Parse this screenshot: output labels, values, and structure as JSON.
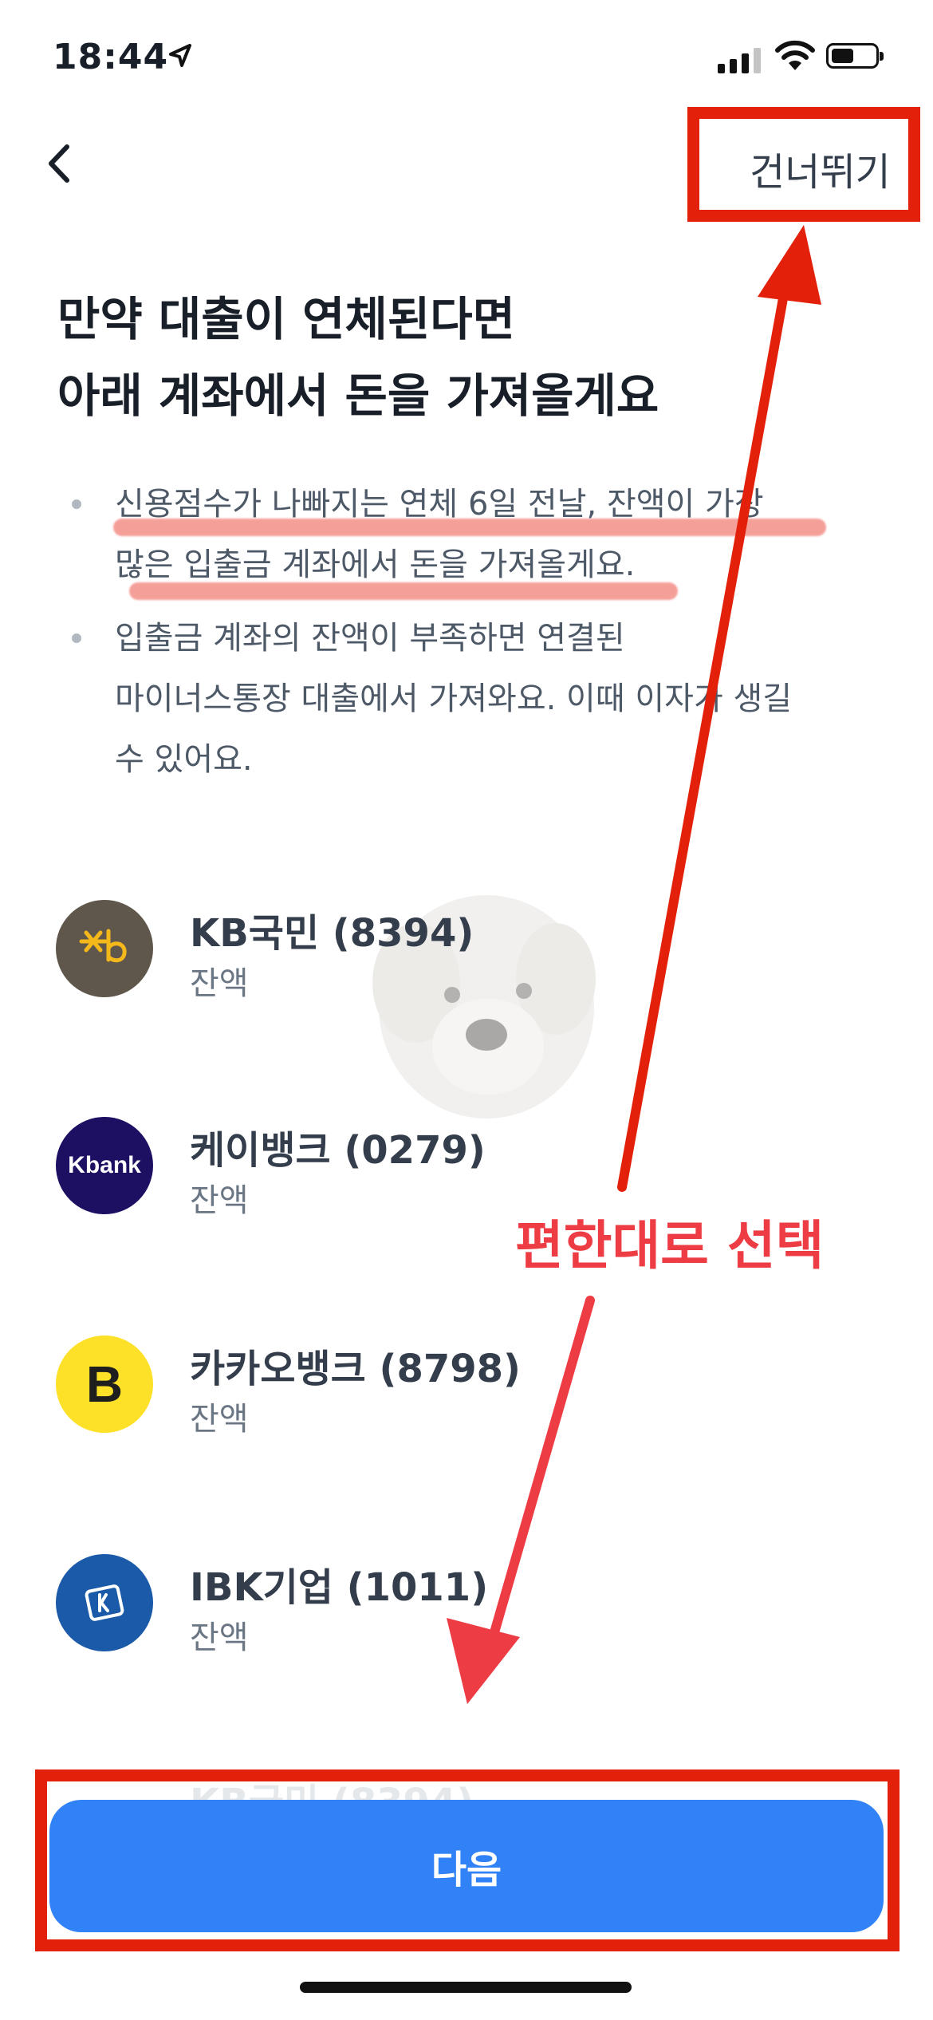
{
  "status_bar": {
    "time": "18:44"
  },
  "nav": {
    "skip_label": "건너뛰기"
  },
  "title": {
    "line1": "만약 대출이 연체된다면",
    "line2": "아래 계좌에서 돈을 가져올게요"
  },
  "bullets": [
    {
      "lines": [
        "신용점수가 나빠지는 연체 6일 전날, 잔액이 가장",
        "많은 입출금 계좌에서 돈을 가져올게요."
      ]
    },
    {
      "lines": [
        "입출금 계좌의 잔액이 부족하면 연결된",
        "마이너스통장 대출에서 가져와요. 이때 이자가 생길",
        "수 있어요."
      ]
    }
  ],
  "accounts": [
    {
      "name": "KB국민 (8394)",
      "balance": "잔액",
      "logo": "kb-logo",
      "color": "#5f574c"
    },
    {
      "name": "케이뱅크 (0279)",
      "balance": "잔액",
      "logo": "kbank-logo",
      "logo_text": "Kbank",
      "color": "#1d1063"
    },
    {
      "name": "카카오뱅크 (8798)",
      "balance": "잔액",
      "logo": "kakaobank-logo",
      "logo_text": "B",
      "color": "#fde128"
    },
    {
      "name": "IBK기업 (1011)",
      "balance": "잔액",
      "logo": "ibk-logo",
      "color": "#1a5aa8"
    }
  ],
  "peek_account": "KB국민 (8394)",
  "annotation": {
    "text": "편한대로 선택",
    "color": "#ee3c45"
  },
  "next_button": {
    "label": "다음",
    "color": "#3182f6"
  },
  "annotation_box_color": "#e3210b"
}
